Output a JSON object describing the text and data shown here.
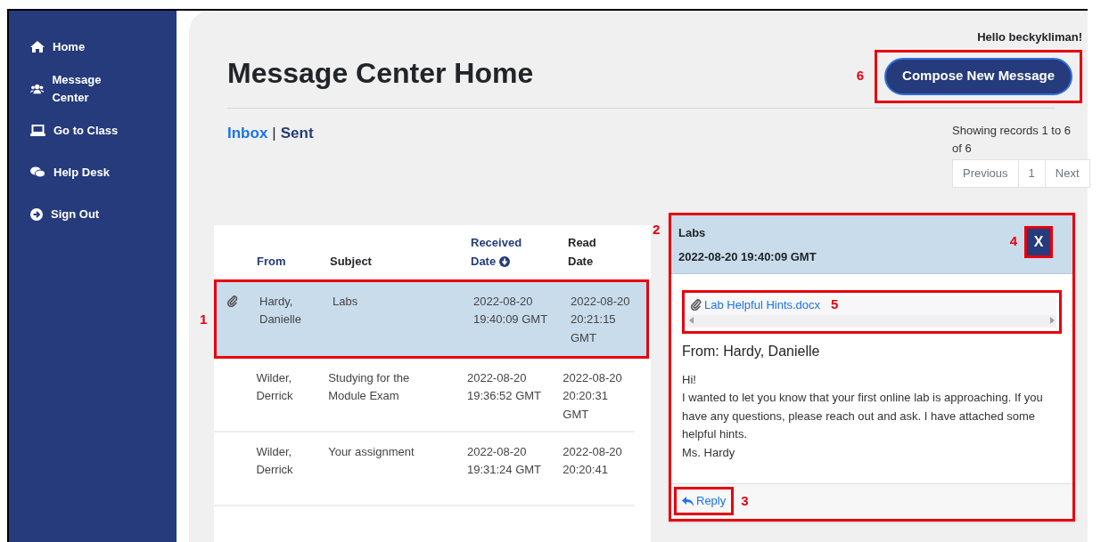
{
  "sidebar": {
    "items": [
      {
        "label": "Home"
      },
      {
        "label": "Message Center"
      },
      {
        "label": "Go to Class"
      },
      {
        "label": "Help Desk"
      },
      {
        "label": "Sign Out"
      }
    ]
  },
  "greeting": "Hello beckykliman!",
  "title": "Message Center Home",
  "compose": {
    "label": "Compose New Message",
    "callout": "6"
  },
  "folders": [
    {
      "label": "Inbox",
      "selected": true
    },
    {
      "label": "Sent",
      "selected": false
    }
  ],
  "folder_separator": "|",
  "records_info": "Showing records 1 to 6 of 6",
  "pagination": [
    {
      "label": "Previous"
    },
    {
      "label": "1"
    },
    {
      "label": "Next"
    }
  ],
  "table": {
    "columns": [
      {
        "label": "From",
        "sortable": true
      },
      {
        "label": "Subject",
        "sortable": false
      },
      {
        "label": "Received Date",
        "sortable": true,
        "sorted": true
      },
      {
        "label": "Read Date",
        "sortable": false
      }
    ],
    "rows": [
      {
        "attachment": true,
        "from": "Hardy, Danielle",
        "subject": "Labs",
        "received": "2022-08-20 19:40:09 GMT",
        "read": "2022-08-20 20:21:15 GMT",
        "selected": true,
        "callout": "1"
      },
      {
        "attachment": false,
        "from": "Wilder, Derrick",
        "subject": "Studying for the Module Exam",
        "received": "2022-08-20 19:36:52 GMT",
        "read": "2022-08-20 20:20:31 GMT",
        "selected": false
      },
      {
        "attachment": false,
        "from": "Wilder, Derrick",
        "subject": "Your assignment",
        "received": "2022-08-20 19:31:24 GMT",
        "read": "2022-08-20 20:20:41",
        "selected": false
      }
    ]
  },
  "detail": {
    "callout": "2",
    "subject": "Labs",
    "date": "2022-08-20 19:40:09 GMT",
    "close": {
      "label": "X",
      "callout": "4"
    },
    "attachment": {
      "label": "Lab Helpful Hints.docx",
      "callout": "5"
    },
    "from": "From: Hardy, Danielle",
    "body": [
      "Hi!",
      "I wanted to let you know that your first online lab is approaching. If you have any questions, please reach out and ask. I have attached some helpful hints.",
      "Ms. Hardy"
    ],
    "reply": {
      "label": "Reply",
      "callout": "3"
    }
  }
}
